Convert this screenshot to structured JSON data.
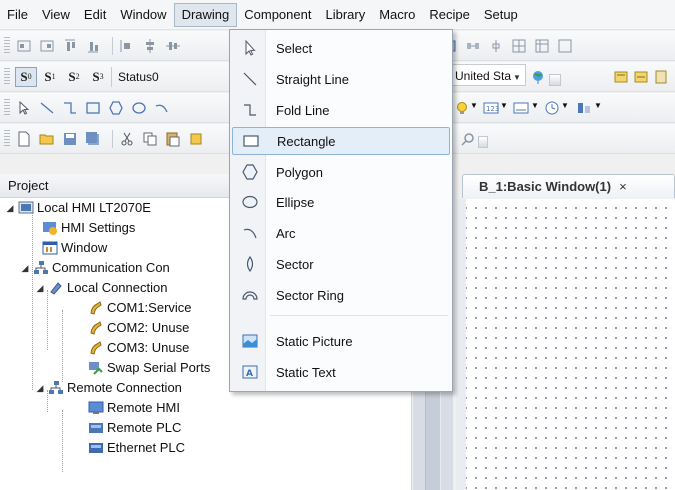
{
  "menubar": {
    "items": [
      "File",
      "View",
      "Edit",
      "Window",
      "Drawing",
      "Component",
      "Library",
      "Macro",
      "Recipe",
      "Setup"
    ],
    "active_index": 4
  },
  "toolbar_status": {
    "state_buttons": [
      "S0",
      "S1",
      "S2",
      "S3"
    ],
    "status_value": "Status0",
    "language_value": "United Sta"
  },
  "drawing_menu": {
    "items": [
      {
        "label": "Select",
        "icon": "cursor-arrow-icon"
      },
      {
        "label": "Straight Line",
        "icon": "straight-line-icon"
      },
      {
        "label": "Fold Line",
        "icon": "fold-line-icon"
      },
      {
        "label": "Rectangle",
        "icon": "rectangle-icon"
      },
      {
        "label": "Polygon",
        "icon": "polygon-icon"
      },
      {
        "label": "Ellipse",
        "icon": "ellipse-icon"
      },
      {
        "label": "Arc",
        "icon": "arc-icon"
      },
      {
        "label": "Sector",
        "icon": "sector-icon"
      },
      {
        "label": "Sector Ring",
        "icon": "sector-ring-icon"
      },
      {
        "label": "Static Picture",
        "icon": "static-picture-icon"
      },
      {
        "label": "Static Text",
        "icon": "static-text-icon"
      }
    ],
    "highlighted": "Rectangle"
  },
  "project_panel": {
    "title": "Project",
    "tree": [
      {
        "label": "Local HMI LT2070E",
        "icon": "hmi-device-icon"
      },
      {
        "label": "HMI Settings",
        "icon": "hmi-settings-icon"
      },
      {
        "label": "Window",
        "icon": "window-icon"
      },
      {
        "label": "Communication Con",
        "icon": "network-icon"
      },
      {
        "label": "Local Connection",
        "icon": "local-connection-icon"
      },
      {
        "label": "COM1:Service",
        "icon": "serial-port-icon"
      },
      {
        "label": "COM2: Unuse",
        "icon": "serial-port-icon"
      },
      {
        "label": "COM3: Unuse",
        "icon": "serial-port-icon"
      },
      {
        "label": "Swap Serial Ports",
        "icon": "swap-ports-icon"
      },
      {
        "label": "Remote Connection",
        "icon": "network-icon"
      },
      {
        "label": "Remote HMI",
        "icon": "remote-hmi-icon"
      },
      {
        "label": "Remote PLC",
        "icon": "remote-plc-icon"
      },
      {
        "label": "Ethernet PLC",
        "icon": "ethernet-plc-icon"
      }
    ]
  },
  "editor": {
    "tab_title": "B_1:Basic Window(1)",
    "tab_close": "×"
  }
}
